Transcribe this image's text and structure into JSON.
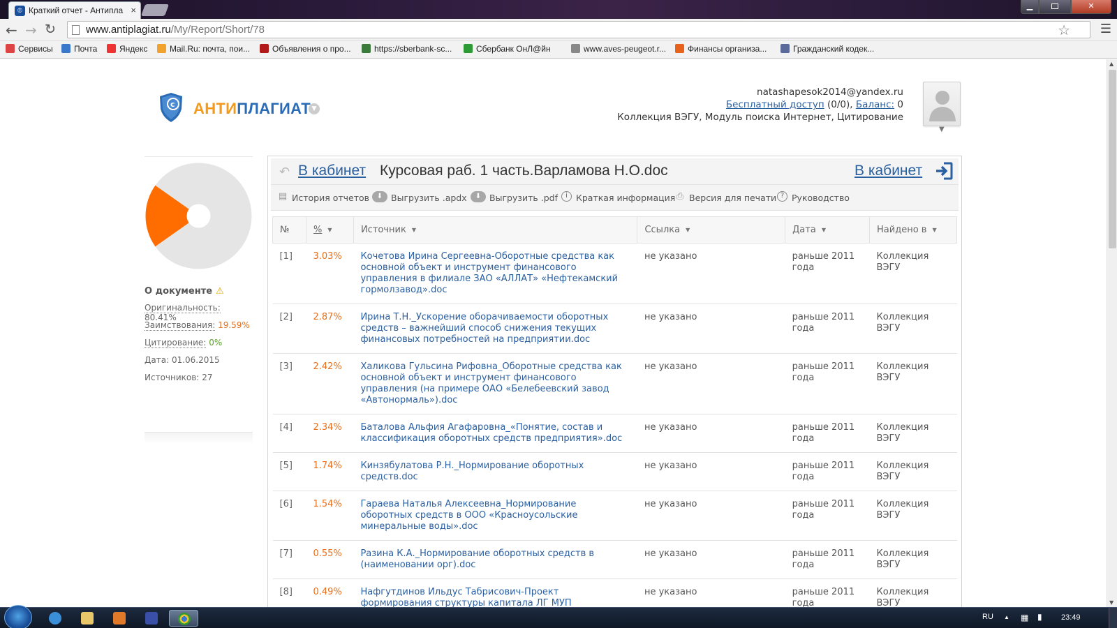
{
  "browser": {
    "tab_title": "Краткий отчет - Антипла",
    "tab_close": "×",
    "url_host": "www.antiplagiat.ru",
    "url_path": "/My/Report/Short/78"
  },
  "bookmarks": [
    {
      "label": "Сервисы",
      "color": "#d44"
    },
    {
      "label": "Почта",
      "color": "#3a78c9"
    },
    {
      "label": "Яндекс",
      "color": "#e33"
    },
    {
      "label": "Mail.Ru: почта, пои...",
      "color": "#f1a22e"
    },
    {
      "label": "Объявления о про...",
      "color": "#b21a1a"
    },
    {
      "label": "https://sberbank-sc...",
      "color": "#3a7a3a"
    },
    {
      "label": "Сбербанк ОнЛ@йн",
      "color": "#2e9a35"
    },
    {
      "label": "www.aves-peugeot.r...",
      "color": "#888"
    },
    {
      "label": "Финансы организа...",
      "color": "#e8621c"
    },
    {
      "label": "Гражданский кодек...",
      "color": "#5a6a9a"
    }
  ],
  "logo": {
    "part1": "АНТИ",
    "part2": "ПЛАГИАТ"
  },
  "user": {
    "email": "natashapesok2014@yandex.ru",
    "access_link": "Бесплатный доступ",
    "access_count": "(0/0),",
    "balance_link": "Баланс:",
    "balance_value": "0",
    "collection": "Коллекция ВЭГУ, Модуль поиска Интернет, Цитирование"
  },
  "doc_info": {
    "heading": "О документе",
    "originality_label": "Оригинальность:",
    "originality_value": "80.41%",
    "borrowing_label": "Заимствования:",
    "borrowing_value": "19.59%",
    "citation_label": "Цитирование:",
    "citation_value": "0%",
    "date_label": "Дата:",
    "date_value": "01.06.2015",
    "sources_label": "Источников:",
    "sources_value": "27"
  },
  "chart_data": {
    "type": "pie",
    "slices": [
      {
        "name": "Оригинальность",
        "value": 80.41,
        "color": "#e5e5e5"
      },
      {
        "name": "Заимствования",
        "value": 19.59,
        "color": "#ff6d00"
      },
      {
        "name": "Цитирование",
        "value": 0,
        "color": "#5b9f2a"
      }
    ]
  },
  "panel": {
    "back_link": "В кабинет",
    "doc_title": "Курсовая раб. 1 часть.Варламова Н.О.doc",
    "right_link": "В кабинет"
  },
  "actions": [
    "История отчетов",
    "Выгрузить .apdx",
    "Выгрузить .pdf",
    "Краткая информация",
    "Версия для печати",
    "Руководство"
  ],
  "table": {
    "headers": {
      "num": "№",
      "pct": "%",
      "source": "Источник",
      "link": "Ссылка",
      "date": "Дата",
      "found": "Найдено в"
    },
    "rows": [
      {
        "num": "[1]",
        "pct": "3.03%",
        "source": "Кочетова Ирина Сергеевна-Оборотные средства как основной объект и инструмент финансового управления в филиале ЗАО «АЛЛАТ» «Нефтекамский гормолзавод».doc",
        "link": "не указано",
        "date": "раньше 2011 года",
        "found": "Коллекция ВЭГУ"
      },
      {
        "num": "[2]",
        "pct": "2.87%",
        "source": "Ирина Т.Н._Ускорение оборачиваемости оборотных средств – важнейший способ снижения текущих финансовых потребностей на предприятии.doc",
        "link": "не указано",
        "date": "раньше 2011 года",
        "found": "Коллекция ВЭГУ"
      },
      {
        "num": "[3]",
        "pct": "2.42%",
        "source": "Халикова Гульсина Рифовна_Оборотные средства как основной объект и инструмент финансового управления (на примере ОАО «Белебеевский завод «Автонормаль»).doc",
        "link": "не указано",
        "date": "раньше 2011 года",
        "found": "Коллекция ВЭГУ"
      },
      {
        "num": "[4]",
        "pct": "2.34%",
        "source": "Баталова Альфия Агафаровна_«Понятие, состав и классификация оборотных средств предприятия».doc",
        "link": "не указано",
        "date": "раньше 2011 года",
        "found": "Коллекция ВЭГУ"
      },
      {
        "num": "[5]",
        "pct": "1.74%",
        "source": "Кинзябулатова Р.Н._Нормирование оборотных средств.doc",
        "link": "не указано",
        "date": "раньше 2011 года",
        "found": "Коллекция ВЭГУ"
      },
      {
        "num": "[6]",
        "pct": "1.54%",
        "source": "Гараева Наталья Алексеевна_Нормирование оборотных средств в ООО «Красноусольские минеральные воды».doc",
        "link": "не указано",
        "date": "раньше 2011 года",
        "found": "Коллекция ВЭГУ"
      },
      {
        "num": "[7]",
        "pct": "0.55%",
        "source": "Разина К.А._Нормирование оборотных средств в (наименовании орг).doc",
        "link": "не указано",
        "date": "раньше 2011 года",
        "found": "Коллекция ВЭГУ"
      },
      {
        "num": "[8]",
        "pct": "0.49%",
        "source": "Нафгутдинов Ильдус Табрисович-Проект формирования структуры капитала ЛГ МУП «Тепловодоканал».doc",
        "link": "не указано",
        "date": "раньше 2011 года",
        "found": "Коллекция ВЭГУ"
      }
    ]
  },
  "taskbar": {
    "lang": "RU",
    "clock": "23:49"
  }
}
